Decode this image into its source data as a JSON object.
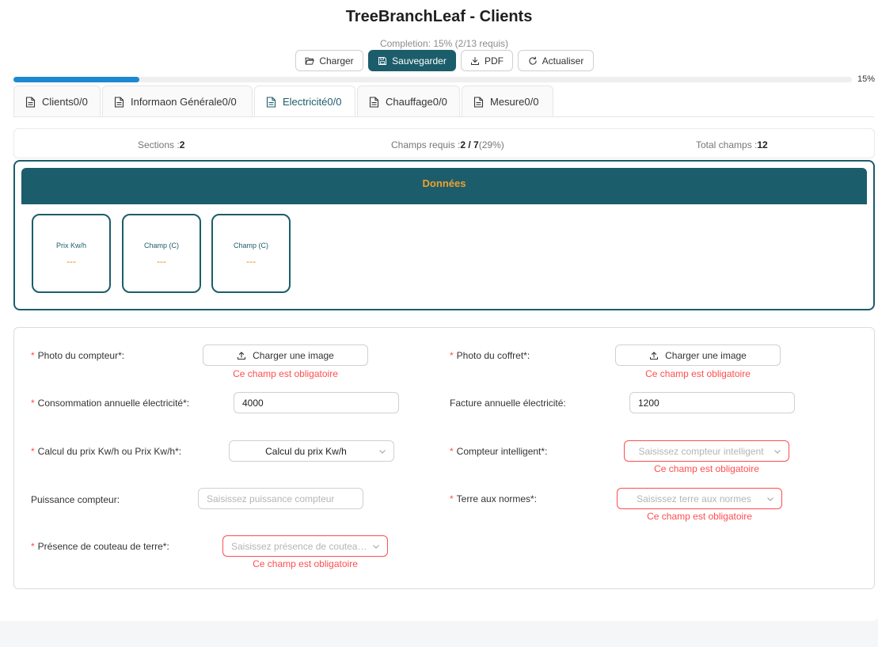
{
  "header": {
    "title": "TreeBranchLeaf - Clients",
    "completion": "Completion: 15% (2/13 requis)"
  },
  "toolbar": {
    "load_label": "Charger",
    "save_label": "Sauvegarder",
    "pdf_label": "PDF",
    "refresh_label": "Actualiser"
  },
  "progress": {
    "value": 0.15,
    "label": "15%"
  },
  "tabs": [
    {
      "label": "Clients0/0"
    },
    {
      "label": "Informaon Générale0/0"
    },
    {
      "label": "Electricité0/0"
    },
    {
      "label": "Chauffage0/0"
    },
    {
      "label": "Mesure0/0"
    }
  ],
  "stats": {
    "sections_label": "Sections :",
    "sections_value": "2",
    "required_label": "Champs requis :",
    "required_value": "2 / 7",
    "required_pct": "(29%)",
    "total_label": "Total champs :",
    "total_value": "12"
  },
  "data_section": {
    "title": "Données",
    "cards": [
      {
        "label": "Prix Kw/h",
        "value": "---"
      },
      {
        "label": "Champ (C)",
        "value": "---"
      },
      {
        "label": "Champ (C)",
        "value": "---"
      }
    ]
  },
  "form": {
    "required_mark": "*",
    "error_text": "Ce champ est obligatoire",
    "upload_label": "Charger une image",
    "photo_compteur": {
      "label": "Photo du compteur*:"
    },
    "photo_coffret": {
      "label": "Photo du coffret*:"
    },
    "conso": {
      "label": "Consommation annuelle électricité*:",
      "value": "4000"
    },
    "facture": {
      "label": "Facture annuelle électricité:",
      "value": "1200"
    },
    "calcul": {
      "label": "Calcul du prix Kw/h ou Prix Kw/h*:",
      "value": "Calcul du prix Kw/h"
    },
    "compteur_intel": {
      "label": "Compteur intelligent*:",
      "placeholder": "Saisissez compteur intelligent"
    },
    "puissance": {
      "label": "Puissance compteur:",
      "placeholder": "Saisissez puissance compteur"
    },
    "terre": {
      "label": "Terre aux normes*:",
      "placeholder": "Saisissez terre aux normes"
    },
    "couteau": {
      "label": "Présence de couteau de terre*:",
      "placeholder": "Saisissez présence de couteau de terre"
    }
  },
  "colors": {
    "primary": "#1c5d6b",
    "accent": "#f0a030",
    "progress": "#1e88d0",
    "error": "#ff4d4f"
  }
}
